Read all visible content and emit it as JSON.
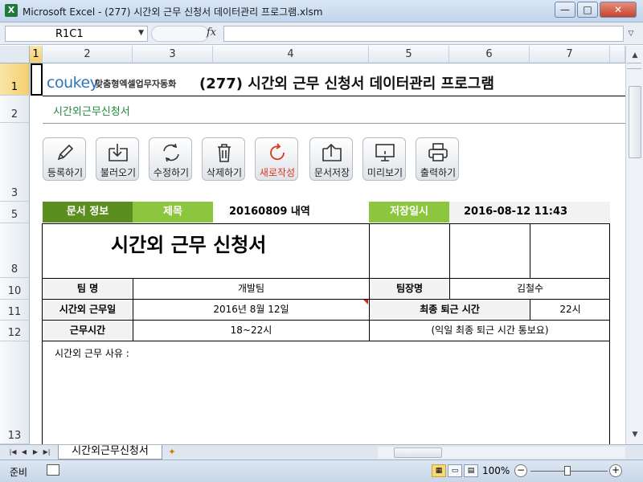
{
  "window": {
    "title": "Microsoft Excel - (277) 시간외 근무 신청서 데이터관리 프로그램.xlsm",
    "app_icon_letter": "X",
    "controls": {
      "minimize": "—",
      "maximize": "□",
      "close": "✕"
    }
  },
  "formula_bar": {
    "name_box": "R1C1",
    "fx_label": "fx",
    "formula": ""
  },
  "grid": {
    "columns": [
      "1",
      "2",
      "3",
      "4",
      "5",
      "6",
      "7"
    ],
    "selected_column": "1",
    "rows": [
      "1",
      "2",
      "3",
      "5",
      "8",
      "10",
      "11",
      "12",
      "13"
    ],
    "selected_row": "1"
  },
  "sheet": {
    "brand_logo": "coukey",
    "brand_tagline": "맞춤형엑셀업무자동화",
    "program_title": "(277) 시간외 근무 신청서 데이터관리 프로그램",
    "subtitle": "시간외근무신청서"
  },
  "toolbar": {
    "buttons": [
      {
        "label": "등록하기",
        "icon": "pencil-icon"
      },
      {
        "label": "불러오기",
        "icon": "download-folder-icon"
      },
      {
        "label": "수정하기",
        "icon": "refresh-icon"
      },
      {
        "label": "삭제하기",
        "icon": "trash-icon"
      },
      {
        "label": "새로작성",
        "icon": "new-refresh-icon"
      },
      {
        "label": "문서저장",
        "icon": "upload-folder-icon"
      },
      {
        "label": "미리보기",
        "icon": "monitor-icon"
      },
      {
        "label": "출력하기",
        "icon": "printer-icon"
      }
    ]
  },
  "info_band": {
    "doc_info_label": "문서 정보",
    "subject_label": "제목",
    "subject_value": "20160809 내역",
    "saved_at_label": "저장일시",
    "saved_at_value": "2016-08-12 11:43"
  },
  "form": {
    "heading": "시간외 근무 신청서",
    "team_label": "팀 명",
    "team_value": "개발팀",
    "leader_label": "팀장명",
    "leader_value": "김철수",
    "date_label": "시간외 근무일",
    "date_value": "2016년 8월 12일",
    "final_leave_label": "최종 퇴근 시간",
    "final_leave_value": "22시",
    "hours_label": "근무시간",
    "hours_value": "18~22시",
    "note_value": "(익일 최종 퇴근 시간 통보요)",
    "reason_label": "시간외 근무 사유 :"
  },
  "tabs": {
    "active_sheet": "시간외근무신청서"
  },
  "status": {
    "ready": "준비",
    "zoom": "100%"
  },
  "colors": {
    "band_dark": "#5a8f1f",
    "band_light": "#8cc63f",
    "subtitle_green": "#1f8a3a",
    "logo_blue": "#2b76b9",
    "new_button_red": "#d9361e"
  }
}
